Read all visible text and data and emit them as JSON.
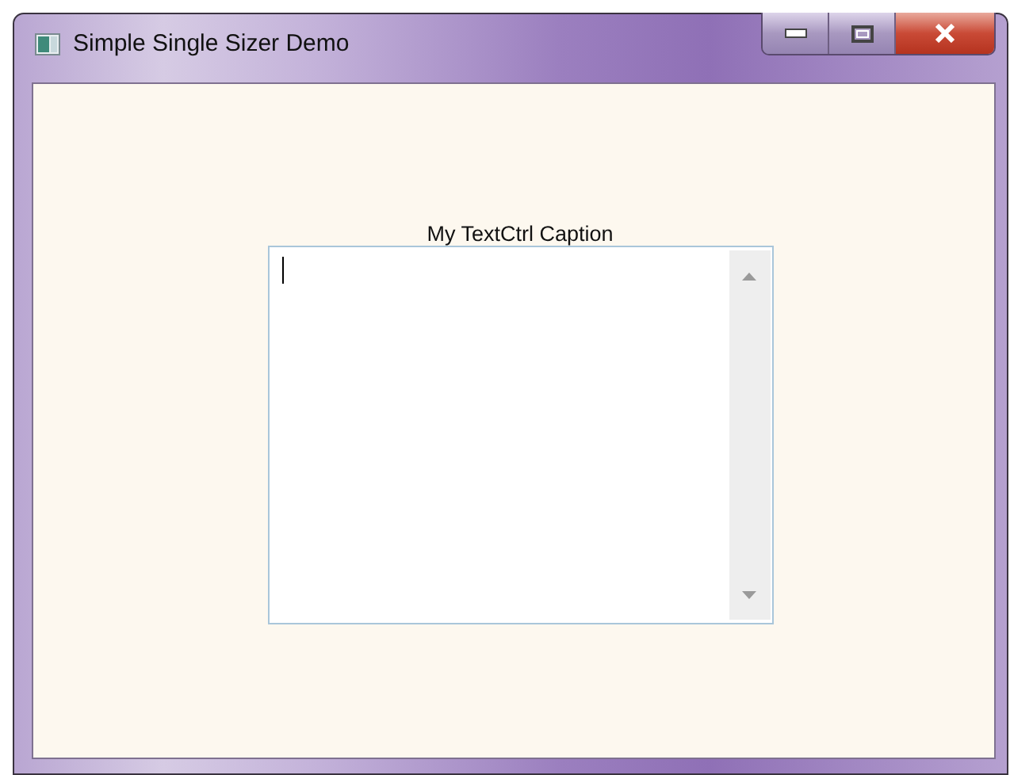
{
  "window": {
    "title": "Simple Single Sizer Demo"
  },
  "caption": "My TextCtrl Caption"
}
